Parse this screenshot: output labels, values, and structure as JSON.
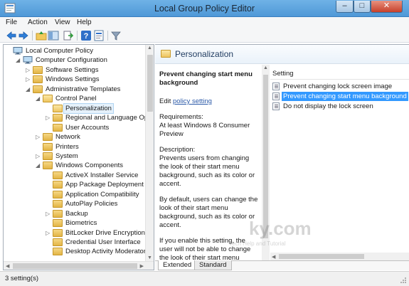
{
  "window": {
    "title": "Local Group Policy Editor",
    "controls": {
      "minimize": "–",
      "maximize": "□",
      "close": "✕"
    }
  },
  "menu": [
    "File",
    "Action",
    "View",
    "Help"
  ],
  "toolbar": {
    "icons": [
      "back-arrow-icon",
      "forward-arrow-icon",
      "up-folder-icon",
      "show-hide-tree-icon",
      "export-list-icon",
      "help-icon",
      "properties-icon",
      "filter-icon"
    ]
  },
  "tree": [
    {
      "label": "Local Computer Policy",
      "level": 0,
      "expander": "",
      "icon": "computer"
    },
    {
      "label": "Computer Configuration",
      "level": 1,
      "expander": "◢",
      "icon": "computer"
    },
    {
      "label": "Software Settings",
      "level": 2,
      "expander": "▷",
      "icon": "folder"
    },
    {
      "label": "Windows Settings",
      "level": 2,
      "expander": "▷",
      "icon": "folder"
    },
    {
      "label": "Administrative Templates",
      "level": 2,
      "expander": "◢",
      "icon": "folder"
    },
    {
      "label": "Control Panel",
      "level": 3,
      "expander": "◢",
      "icon": "folder-open"
    },
    {
      "label": "Personalization",
      "level": 4,
      "expander": "",
      "icon": "folder-open",
      "selected": true
    },
    {
      "label": "Regional and Language Optio",
      "level": 4,
      "expander": "▷",
      "icon": "folder"
    },
    {
      "label": "User Accounts",
      "level": 4,
      "expander": "",
      "icon": "folder"
    },
    {
      "label": "Network",
      "level": 3,
      "expander": "▷",
      "icon": "folder"
    },
    {
      "label": "Printers",
      "level": 3,
      "expander": "",
      "icon": "folder"
    },
    {
      "label": "System",
      "level": 3,
      "expander": "▷",
      "icon": "folder"
    },
    {
      "label": "Windows Components",
      "level": 3,
      "expander": "◢",
      "icon": "folder"
    },
    {
      "label": "ActiveX Installer Service",
      "level": 4,
      "expander": "",
      "icon": "folder"
    },
    {
      "label": "App Package Deployment",
      "level": 4,
      "expander": "",
      "icon": "folder"
    },
    {
      "label": "Application Compatibility",
      "level": 4,
      "expander": "",
      "icon": "folder"
    },
    {
      "label": "AutoPlay Policies",
      "level": 4,
      "expander": "",
      "icon": "folder"
    },
    {
      "label": "Backup",
      "level": 4,
      "expander": "▷",
      "icon": "folder"
    },
    {
      "label": "Biometrics",
      "level": 4,
      "expander": "",
      "icon": "folder"
    },
    {
      "label": "BitLocker Drive Encryption",
      "level": 4,
      "expander": "▷",
      "icon": "folder"
    },
    {
      "label": "Credential User Interface",
      "level": 4,
      "expander": "",
      "icon": "folder"
    },
    {
      "label": "Desktop Activity Moderator",
      "level": 4,
      "expander": "",
      "icon": "folder"
    }
  ],
  "right": {
    "header": "Personalization",
    "policy_title": "Prevent changing start menu background",
    "edit_prefix": "Edit ",
    "edit_link": "policy setting",
    "requirements": "Requirements:\nAt least Windows 8 Consumer Preview",
    "description": "Description:\nPrevents users from changing the look of their start menu background, such as its color or accent.",
    "default_text": "By default, users can change the look of their start menu background, such as its color or accent.",
    "enable_text": "If you enable this setting, the user will not be able to change the look of their start menu background,",
    "column_header": "Setting",
    "settings": [
      {
        "label": "Prevent changing lock screen image",
        "selected": false
      },
      {
        "label": "Prevent changing start menu background",
        "selected": true
      },
      {
        "label": "Do not display the lock screen",
        "selected": false
      }
    ],
    "tabs": [
      "Extended",
      "Standard"
    ]
  },
  "status": {
    "text": "3 setting(s)"
  },
  "watermark": {
    "logo": "ky.com",
    "tagline": "Tech Help and Tutorial"
  }
}
